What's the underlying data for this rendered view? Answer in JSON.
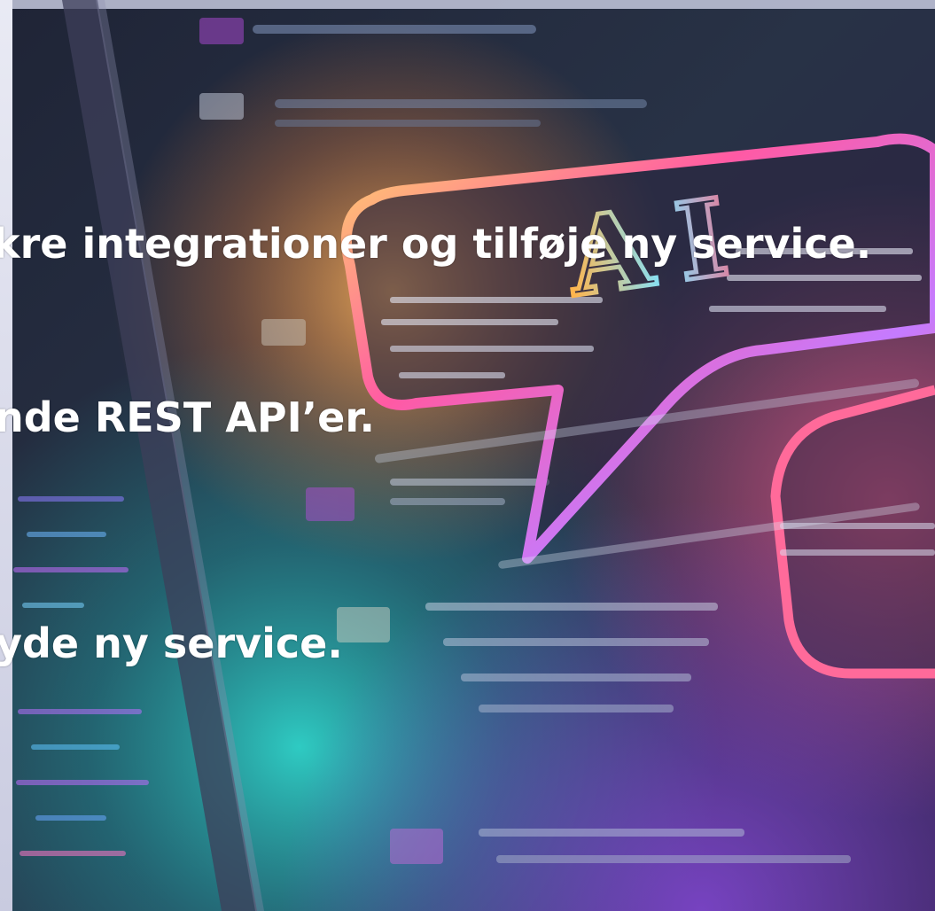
{
  "slide": {
    "lines": [
      "kre integrationer og tilføje ny service.",
      "nde REST API’er.",
      "yde ny service."
    ]
  },
  "background": {
    "illustration": "ai-speech-bubble-code-screen",
    "emblem_text": "AI"
  },
  "colors": {
    "text": "#ffffff",
    "bubble_stroke": "#ff5ea8",
    "accent_cyan": "#3bd6d0",
    "accent_purple": "#a35cf0",
    "accent_orange": "#ffb347"
  }
}
